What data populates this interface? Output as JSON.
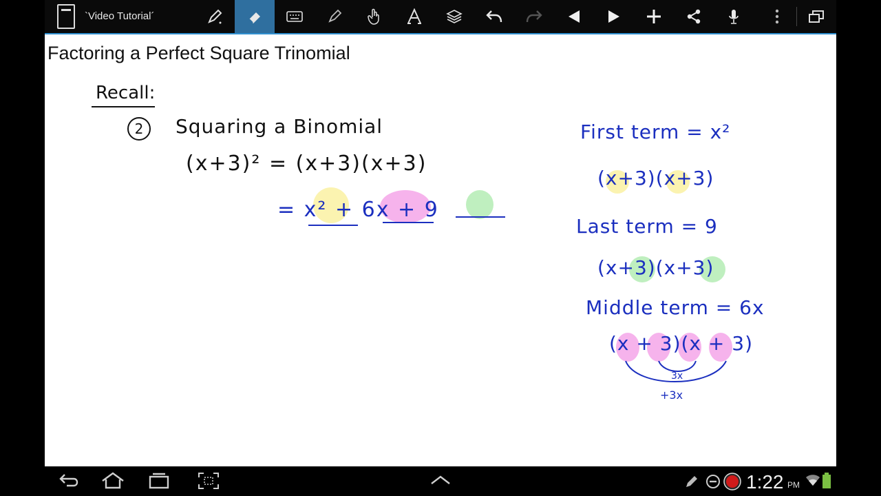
{
  "toolbar": {
    "title": "`Video Tutorial´",
    "tools": [
      {
        "icon": "pen-icon"
      },
      {
        "icon": "eraser-icon",
        "active": true
      },
      {
        "icon": "keyboard-icon"
      },
      {
        "icon": "highlighter-icon"
      },
      {
        "icon": "hand-icon"
      },
      {
        "icon": "text-icon"
      },
      {
        "icon": "layers-icon"
      },
      {
        "icon": "undo-icon"
      },
      {
        "icon": "redo-icon",
        "disabled": true
      },
      {
        "icon": "previous-page-icon"
      },
      {
        "icon": "next-page-icon"
      },
      {
        "icon": "add-page-icon"
      },
      {
        "icon": "share-icon"
      },
      {
        "icon": "microphone-icon"
      },
      {
        "icon": "more-icon"
      },
      {
        "icon": "window-icon"
      }
    ],
    "accent_color": "#2f8fd0"
  },
  "canvas": {
    "title": "Factoring a Perfect Square Trinomial",
    "recall": "Recall:",
    "number": "2",
    "heading": "Squaring a Binomial",
    "eq1": "(x+3)² = (x+3)(x+3)",
    "eq2": "=  x²  +  6x  +  9",
    "notes": {
      "first_term": "First term = x²",
      "fact1": "(x+3)(x+3)",
      "last_term": "Last term = 9",
      "fact2": "(x+3)(x+3)",
      "middle_term": "Middle term = 6x",
      "fact3": "(x + 3)(x + 3)",
      "inner": "3x",
      "outer": "+3x"
    },
    "ink_color": "#1b2fbf",
    "highlight_colors": {
      "yellow": "#fbf3b0",
      "pink": "#f6b3ec",
      "green": "#bfefbf"
    }
  },
  "navbar": {
    "buttons": [
      "back-icon",
      "home-icon",
      "recent-apps-icon",
      "screenshot-icon",
      "menu-up-icon"
    ],
    "status": [
      "pen-status-icon",
      "do-not-disturb-icon",
      "record-icon",
      "wifi-icon",
      "battery-icon"
    ],
    "time": "1:22",
    "ampm": "PM"
  }
}
